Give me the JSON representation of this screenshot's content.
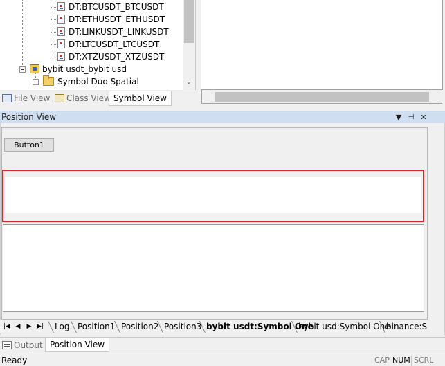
{
  "tree": {
    "leaf_items": [
      {
        "label": "DT:BTCUSDT_BTCUSDT"
      },
      {
        "label": "DT:ETHUSDT_ETHUSDT"
      },
      {
        "label": "DT:LINKUSDT_LINKUSDT"
      },
      {
        "label": "DT:LTCUSDT_LTCUSDT"
      },
      {
        "label": "DT:XTZUSDT_XTZUSDT"
      }
    ],
    "project_label": "bybit usdt_bybit usd",
    "folder_label": "Symbol Duo Spatial"
  },
  "tree_tabs": [
    {
      "label": "File View"
    },
    {
      "label": "Class View"
    },
    {
      "label": "Symbol View"
    }
  ],
  "position_view": {
    "title": "Position View",
    "dropdown_glyph": "▼",
    "pin_glyph": "📌",
    "close_glyph": "✕",
    "button1_label": "Button1"
  },
  "sheet_tabs": {
    "nav_glyphs": [
      "⏮",
      "◀",
      "▶",
      "⏭"
    ],
    "tabs": [
      {
        "label": "Log"
      },
      {
        "label": "Position1"
      },
      {
        "label": "Position2"
      },
      {
        "label": "Position3"
      },
      {
        "label": "bybit usdt:Symbol One"
      },
      {
        "label": "bybit usd:Symbol One"
      },
      {
        "label": "binance:Sy"
      }
    ],
    "active_tab": "bybit usdt:Symbol One"
  },
  "bottom_tabs": [
    {
      "label": "Output"
    },
    {
      "label": "Position View"
    }
  ],
  "status": {
    "text": "Ready",
    "indicators": [
      {
        "label": "CAP"
      },
      {
        "label": "NUM"
      },
      {
        "label": "SCRL"
      }
    ]
  },
  "colors": {
    "highlight_border": "#d9262a",
    "pane_header": "#cfdef0"
  }
}
